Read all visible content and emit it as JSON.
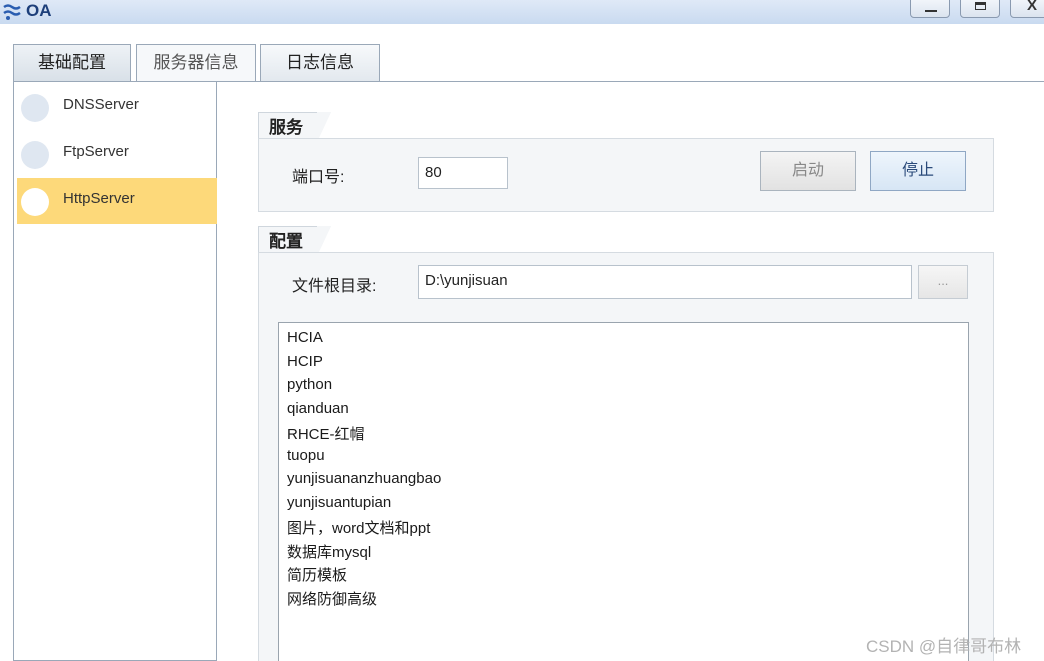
{
  "window": {
    "title": "OA",
    "minimize_glyph": "_",
    "maximize_glyph": "□",
    "close_glyph": "X"
  },
  "tabs": [
    {
      "label": "基础配置",
      "selected": true
    },
    {
      "label": "服务器信息",
      "selected": false
    },
    {
      "label": "日志信息",
      "selected": false
    }
  ],
  "servers": [
    {
      "label": "DNSServer",
      "selected": false
    },
    {
      "label": "FtpServer",
      "selected": false
    },
    {
      "label": "HttpServer",
      "selected": true
    }
  ],
  "service": {
    "group_title": "服务",
    "port_label": "端口号:",
    "port_value": "80",
    "start_label": "启动",
    "stop_label": "停止"
  },
  "config": {
    "group_title": "配置",
    "root_label": "文件根目录:",
    "root_value": "D:\\yunjisuan",
    "browse_label": "...",
    "files": [
      "HCIA",
      "HCIP",
      "python",
      "qianduan",
      "RHCE-红帽",
      "tuopu",
      "yunjisuananzhuangbao",
      "yunjisuantupian",
      "图片，word文档和ppt",
      "数据库mysql",
      "简历模板",
      "网络防御高级"
    ]
  },
  "watermark": "CSDN @自律哥布林",
  "colors": {
    "selected_item": "#fdd97a",
    "title_bar": "#c9daf0",
    "panel_bg": "#f4f6f8"
  }
}
